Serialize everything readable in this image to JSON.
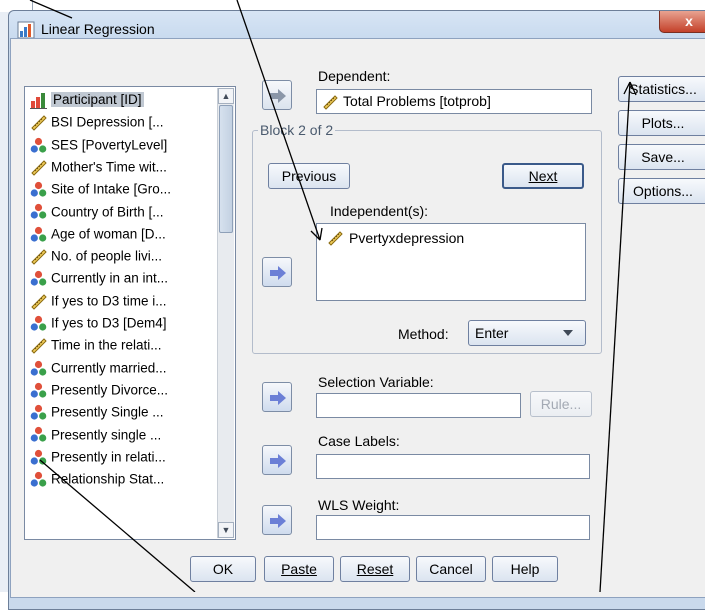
{
  "window": {
    "title": "Linear Regression",
    "close_label": "x"
  },
  "variables": [
    {
      "label": "Participant [ID]",
      "icon": "nominal-id-icon",
      "selected": true
    },
    {
      "label": "BSI Depression [...",
      "icon": "scale-ruler-icon"
    },
    {
      "label": "SES [PovertyLevel]",
      "icon": "nominal-balls-icon"
    },
    {
      "label": "Mother's Time wit...",
      "icon": "scale-ruler-icon"
    },
    {
      "label": "Site of Intake [Gro...",
      "icon": "nominal-balls-icon"
    },
    {
      "label": "Country of Birth [...",
      "icon": "nominal-balls-icon"
    },
    {
      "label": "Age of woman [D...",
      "icon": "nominal-balls-icon"
    },
    {
      "label": "No. of people livi...",
      "icon": "scale-ruler-icon"
    },
    {
      "label": "Currently in an int...",
      "icon": "nominal-balls-icon"
    },
    {
      "label": "If yes to D3 time i...",
      "icon": "scale-ruler-icon"
    },
    {
      "label": "If yes to D3 [Dem4]",
      "icon": "nominal-balls-icon"
    },
    {
      "label": "Time in the relati...",
      "icon": "scale-ruler-icon"
    },
    {
      "label": "Currently married...",
      "icon": "nominal-balls-icon"
    },
    {
      "label": "Presently Divorce...",
      "icon": "nominal-balls-icon"
    },
    {
      "label": "Presently Single ...",
      "icon": "nominal-balls-icon"
    },
    {
      "label": "Presently single ...",
      "icon": "nominal-balls-icon"
    },
    {
      "label": "Presently in relati...",
      "icon": "nominal-balls-icon"
    },
    {
      "label": "Relationship Stat...",
      "icon": "nominal-balls-icon"
    }
  ],
  "dependent": {
    "label": "Dependent:",
    "value": "Total Problems [totprob]"
  },
  "block": {
    "title": "Block 2 of 2",
    "previous": "Previous",
    "next": "Next"
  },
  "independent": {
    "label": "Independent(s):",
    "items": [
      "Pvertyxdepression"
    ]
  },
  "method": {
    "label": "Method:",
    "value": "Enter"
  },
  "selection": {
    "label": "Selection Variable:",
    "rule_button": "Rule..."
  },
  "case_labels": {
    "label": "Case Labels:"
  },
  "wls": {
    "label": "WLS Weight:"
  },
  "side_buttons": {
    "statistics": "Statistics...",
    "plots": "Plots...",
    "save": "Save...",
    "options": "Options..."
  },
  "bottom_buttons": {
    "ok": "OK",
    "paste": "Paste",
    "reset": "Reset",
    "cancel": "Cancel",
    "help": "Help"
  },
  "colors": {
    "arrow": "#6b7fd6",
    "dialog_frame": "#c9d9ec",
    "client_bg": "#f0f0f0"
  }
}
